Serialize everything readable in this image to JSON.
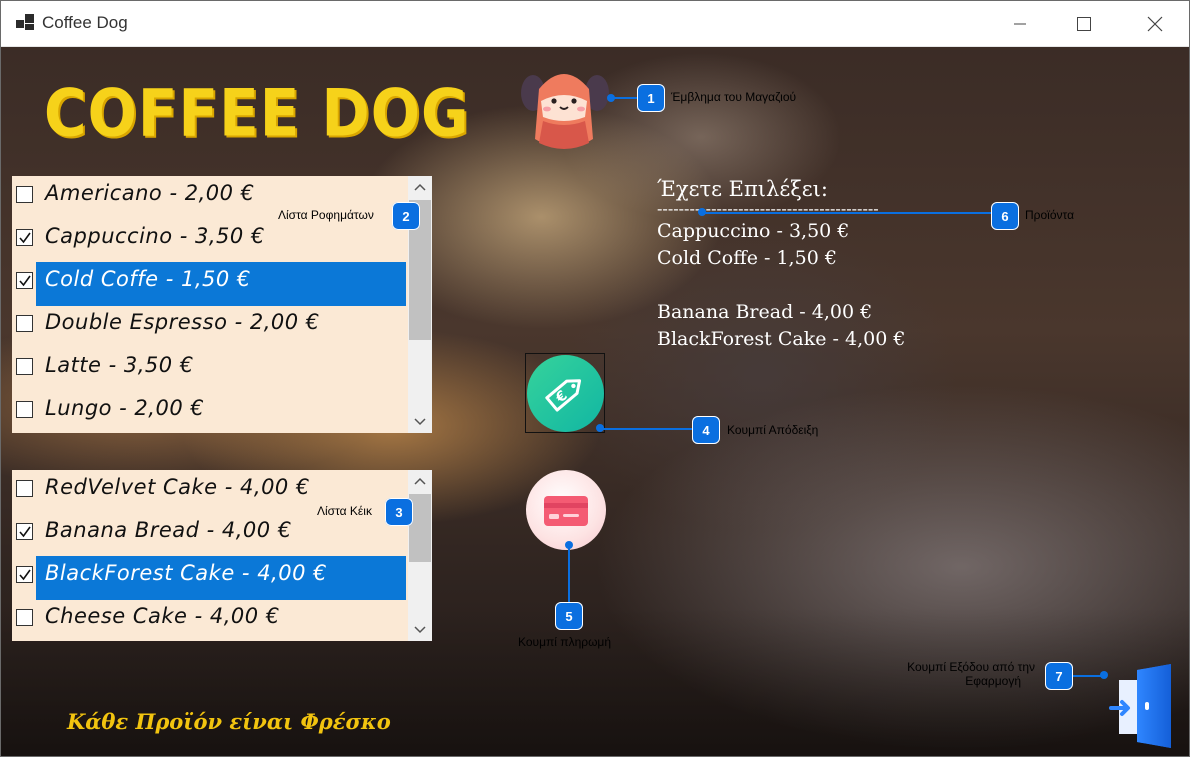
{
  "window": {
    "title": "Coffee Dog",
    "controls": {
      "minimize": "—",
      "maximize": "☐",
      "close": "✕"
    }
  },
  "brand": {
    "title": "COFFEE DOG"
  },
  "drinks": {
    "items": [
      {
        "label": "Americano - 2,00 €",
        "checked": false,
        "selected": false
      },
      {
        "label": "Cappuccino - 3,50 €",
        "checked": true,
        "selected": false
      },
      {
        "label": "Cold Coffe - 1,50 €",
        "checked": true,
        "selected": true
      },
      {
        "label": "Double Espresso - 2,00 €",
        "checked": false,
        "selected": false
      },
      {
        "label": "Latte - 3,50 €",
        "checked": false,
        "selected": false
      },
      {
        "label": "Lungo - 2,00 €",
        "checked": false,
        "selected": false
      }
    ]
  },
  "cakes": {
    "items": [
      {
        "label": "RedVelvet Cake - 4,00 €",
        "checked": false,
        "selected": false
      },
      {
        "label": "Banana Bread - 4,00 €",
        "checked": true,
        "selected": false
      },
      {
        "label": "BlackForest Cake - 4,00 €",
        "checked": true,
        "selected": true
      },
      {
        "label": "Cheese Cake - 4,00 €",
        "checked": false,
        "selected": false
      }
    ]
  },
  "summary": {
    "heading": "Έχετε Επιλέξει:",
    "separator": "-----------------------------------------",
    "drinks": [
      "Cappuccino - 3,50 €",
      "Cold Coffe - 1,50 €"
    ],
    "cakes": [
      "Banana Bread - 4,00 €",
      "BlackForest Cake - 4,00 €"
    ]
  },
  "annotations": {
    "a1": {
      "num": "1",
      "label": "Έμβλημα του Μαγαζιού"
    },
    "a2": {
      "num": "2",
      "label": "Λίστα Ροφημάτων"
    },
    "a3": {
      "num": "3",
      "label": "Λίστα Κέικ"
    },
    "a4": {
      "num": "4",
      "label": "Κουμπί Απόδειξη"
    },
    "a5": {
      "num": "5",
      "label": "Κουμπί πληρωμή"
    },
    "a6": {
      "num": "6",
      "label": "Προϊόντα"
    },
    "a7": {
      "num": "7",
      "label_line1": "Κουμπί Εξόδου από την",
      "label_line2": "Εφαρμογή"
    }
  },
  "footer": {
    "text": "Κάθε Προϊόν είναι Φρέσκο"
  },
  "colors": {
    "accent": "#0b78d7",
    "brand_yellow": "#f6d21a",
    "annotation": "#0a6fe0",
    "list_bg": "#fbe9d5"
  },
  "icons": {
    "logo": "dog-logo-icon",
    "receipt": "euro-tag-icon",
    "payment": "credit-card-icon",
    "exit": "exit-door-icon"
  }
}
